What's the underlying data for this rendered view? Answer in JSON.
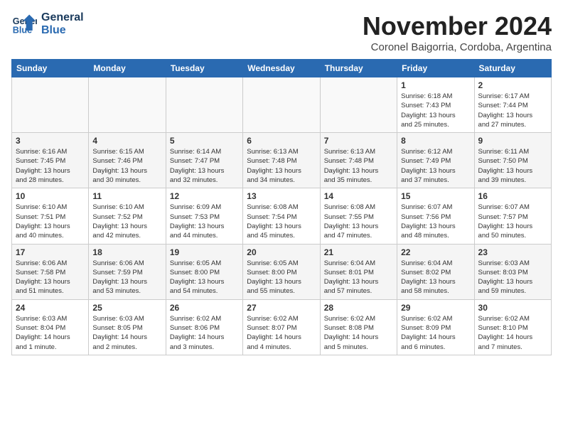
{
  "header": {
    "logo_line1": "General",
    "logo_line2": "Blue",
    "month_title": "November 2024",
    "subtitle": "Coronel Baigorria, Cordoba, Argentina"
  },
  "weekdays": [
    "Sunday",
    "Monday",
    "Tuesday",
    "Wednesday",
    "Thursday",
    "Friday",
    "Saturday"
  ],
  "weeks": [
    [
      {
        "day": "",
        "info": ""
      },
      {
        "day": "",
        "info": ""
      },
      {
        "day": "",
        "info": ""
      },
      {
        "day": "",
        "info": ""
      },
      {
        "day": "",
        "info": ""
      },
      {
        "day": "1",
        "info": "Sunrise: 6:18 AM\nSunset: 7:43 PM\nDaylight: 13 hours\nand 25 minutes."
      },
      {
        "day": "2",
        "info": "Sunrise: 6:17 AM\nSunset: 7:44 PM\nDaylight: 13 hours\nand 27 minutes."
      }
    ],
    [
      {
        "day": "3",
        "info": "Sunrise: 6:16 AM\nSunset: 7:45 PM\nDaylight: 13 hours\nand 28 minutes."
      },
      {
        "day": "4",
        "info": "Sunrise: 6:15 AM\nSunset: 7:46 PM\nDaylight: 13 hours\nand 30 minutes."
      },
      {
        "day": "5",
        "info": "Sunrise: 6:14 AM\nSunset: 7:47 PM\nDaylight: 13 hours\nand 32 minutes."
      },
      {
        "day": "6",
        "info": "Sunrise: 6:13 AM\nSunset: 7:48 PM\nDaylight: 13 hours\nand 34 minutes."
      },
      {
        "day": "7",
        "info": "Sunrise: 6:13 AM\nSunset: 7:48 PM\nDaylight: 13 hours\nand 35 minutes."
      },
      {
        "day": "8",
        "info": "Sunrise: 6:12 AM\nSunset: 7:49 PM\nDaylight: 13 hours\nand 37 minutes."
      },
      {
        "day": "9",
        "info": "Sunrise: 6:11 AM\nSunset: 7:50 PM\nDaylight: 13 hours\nand 39 minutes."
      }
    ],
    [
      {
        "day": "10",
        "info": "Sunrise: 6:10 AM\nSunset: 7:51 PM\nDaylight: 13 hours\nand 40 minutes."
      },
      {
        "day": "11",
        "info": "Sunrise: 6:10 AM\nSunset: 7:52 PM\nDaylight: 13 hours\nand 42 minutes."
      },
      {
        "day": "12",
        "info": "Sunrise: 6:09 AM\nSunset: 7:53 PM\nDaylight: 13 hours\nand 44 minutes."
      },
      {
        "day": "13",
        "info": "Sunrise: 6:08 AM\nSunset: 7:54 PM\nDaylight: 13 hours\nand 45 minutes."
      },
      {
        "day": "14",
        "info": "Sunrise: 6:08 AM\nSunset: 7:55 PM\nDaylight: 13 hours\nand 47 minutes."
      },
      {
        "day": "15",
        "info": "Sunrise: 6:07 AM\nSunset: 7:56 PM\nDaylight: 13 hours\nand 48 minutes."
      },
      {
        "day": "16",
        "info": "Sunrise: 6:07 AM\nSunset: 7:57 PM\nDaylight: 13 hours\nand 50 minutes."
      }
    ],
    [
      {
        "day": "17",
        "info": "Sunrise: 6:06 AM\nSunset: 7:58 PM\nDaylight: 13 hours\nand 51 minutes."
      },
      {
        "day": "18",
        "info": "Sunrise: 6:06 AM\nSunset: 7:59 PM\nDaylight: 13 hours\nand 53 minutes."
      },
      {
        "day": "19",
        "info": "Sunrise: 6:05 AM\nSunset: 8:00 PM\nDaylight: 13 hours\nand 54 minutes."
      },
      {
        "day": "20",
        "info": "Sunrise: 6:05 AM\nSunset: 8:00 PM\nDaylight: 13 hours\nand 55 minutes."
      },
      {
        "day": "21",
        "info": "Sunrise: 6:04 AM\nSunset: 8:01 PM\nDaylight: 13 hours\nand 57 minutes."
      },
      {
        "day": "22",
        "info": "Sunrise: 6:04 AM\nSunset: 8:02 PM\nDaylight: 13 hours\nand 58 minutes."
      },
      {
        "day": "23",
        "info": "Sunrise: 6:03 AM\nSunset: 8:03 PM\nDaylight: 13 hours\nand 59 minutes."
      }
    ],
    [
      {
        "day": "24",
        "info": "Sunrise: 6:03 AM\nSunset: 8:04 PM\nDaylight: 14 hours\nand 1 minute."
      },
      {
        "day": "25",
        "info": "Sunrise: 6:03 AM\nSunset: 8:05 PM\nDaylight: 14 hours\nand 2 minutes."
      },
      {
        "day": "26",
        "info": "Sunrise: 6:02 AM\nSunset: 8:06 PM\nDaylight: 14 hours\nand 3 minutes."
      },
      {
        "day": "27",
        "info": "Sunrise: 6:02 AM\nSunset: 8:07 PM\nDaylight: 14 hours\nand 4 minutes."
      },
      {
        "day": "28",
        "info": "Sunrise: 6:02 AM\nSunset: 8:08 PM\nDaylight: 14 hours\nand 5 minutes."
      },
      {
        "day": "29",
        "info": "Sunrise: 6:02 AM\nSunset: 8:09 PM\nDaylight: 14 hours\nand 6 minutes."
      },
      {
        "day": "30",
        "info": "Sunrise: 6:02 AM\nSunset: 8:10 PM\nDaylight: 14 hours\nand 7 minutes."
      }
    ]
  ]
}
